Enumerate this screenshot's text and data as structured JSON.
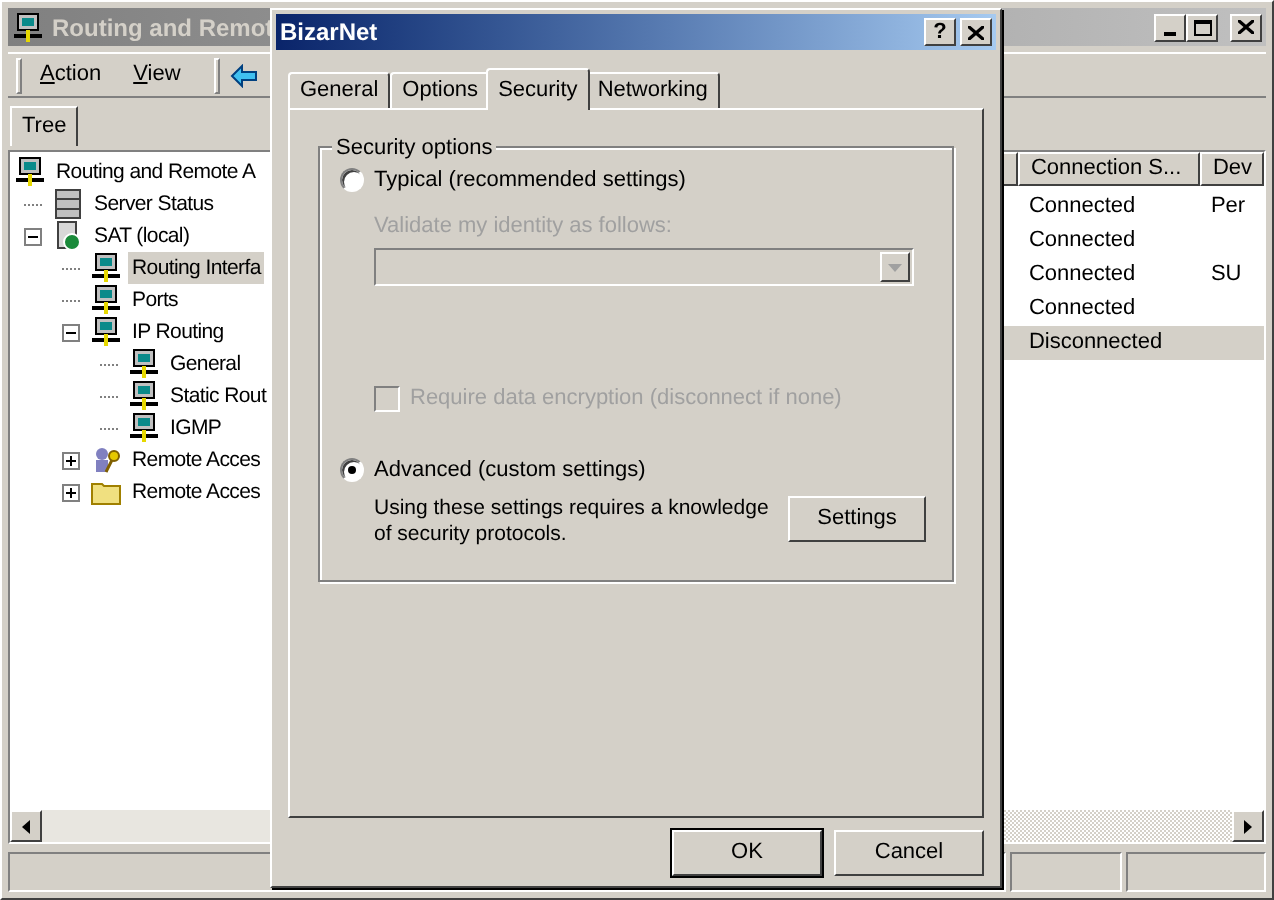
{
  "main_window": {
    "title": "Routing and Remot",
    "menu": [
      {
        "label": "Action"
      },
      {
        "label": "View"
      }
    ],
    "tabs": [
      {
        "label": "Tree",
        "selected": true
      }
    ],
    "tree": [
      {
        "label": "Routing and Remote A",
        "kind": "computer",
        "selected": false,
        "children": [
          {
            "label": "Server Status",
            "kind": "servers",
            "selected": false
          },
          {
            "label": "SAT (local)",
            "kind": "server",
            "selected": false,
            "expanded": true,
            "children": [
              {
                "label": "Routing Interfa",
                "kind": "network",
                "selected": true
              },
              {
                "label": "Ports",
                "kind": "network",
                "selected": false
              },
              {
                "label": "IP Routing",
                "kind": "network",
                "selected": false,
                "expanded": true,
                "children": [
                  {
                    "label": "General",
                    "kind": "network",
                    "selected": false
                  },
                  {
                    "label": "Static Rout",
                    "kind": "network",
                    "selected": false
                  },
                  {
                    "label": "IGMP",
                    "kind": "network",
                    "selected": false
                  }
                ]
              },
              {
                "label": "Remote Acces",
                "kind": "policy",
                "selected": false,
                "expanded": false
              },
              {
                "label": "Remote Acces",
                "kind": "folder",
                "selected": false,
                "expanded": false
              }
            ]
          }
        ]
      }
    ],
    "list": {
      "columns": [
        "Connection S...",
        "Dev"
      ],
      "rows": [
        {
          "cells": [
            "Connected",
            "Per"
          ],
          "selected": false
        },
        {
          "cells": [
            "Connected",
            ""
          ],
          "selected": false
        },
        {
          "cells": [
            "Connected",
            "SU"
          ],
          "selected": false
        },
        {
          "cells": [
            "Connected",
            ""
          ],
          "selected": false
        },
        {
          "cells": [
            "Disconnected",
            ""
          ],
          "selected": true
        }
      ]
    }
  },
  "dialog": {
    "title": "BizarNet",
    "help": "?",
    "tabs": [
      {
        "label": "General",
        "selected": false
      },
      {
        "label": "Options",
        "selected": false
      },
      {
        "label": "Security",
        "selected": true
      },
      {
        "label": "Networking",
        "selected": false
      }
    ],
    "legend": "Security options",
    "radios": [
      {
        "label": "Typical (recommended settings)",
        "selected": false
      },
      {
        "label": "Advanced (custom settings)",
        "selected": true
      }
    ],
    "validate": {
      "label": "Validate my identity as follows:",
      "disabled": true
    },
    "encryption": {
      "label": "Require data encryption (disconnect if none)",
      "checked": false,
      "disabled": true
    },
    "note": "Using these settings requires a knowledge\nof security protocols.",
    "settings_button": "Settings",
    "buttons": [
      {
        "label": "OK",
        "default": true
      },
      {
        "label": "Cancel",
        "default": false
      }
    ]
  }
}
